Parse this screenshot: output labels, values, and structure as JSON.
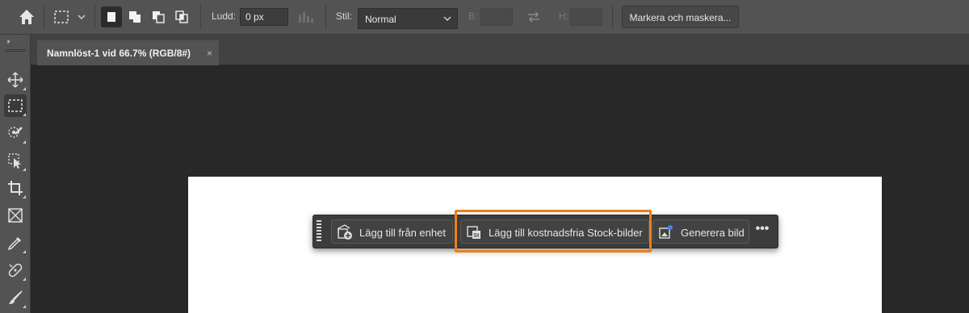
{
  "options_bar": {
    "feather_label": "Ludd:",
    "feather_value": "0 px",
    "style_label": "Stil:",
    "style_value": "Normal",
    "width_label": "B:",
    "height_label": "H:",
    "select_mask_label": "Markera och maskera..."
  },
  "document_tab": {
    "title": "Namnlöst-1 vid 66.7% (RGB/8#)",
    "close_glyph": "×"
  },
  "toolbar": {
    "collapse_glyph": "››",
    "tools": [
      "move-icon",
      "rect-marquee-icon",
      "object-select-icon",
      "quick-select-icon",
      "crop-icon",
      "frame-icon",
      "eyedropper-icon",
      "healing-brush-icon",
      "brush-icon"
    ]
  },
  "context_task_bar": {
    "add_from_device": "Lägg till från enhet",
    "add_stock_images": "Lägg till kostnadsfria Stock-bilder",
    "generate_image": "Generera bild",
    "more_glyph": "•••"
  },
  "colors": {
    "highlight": "#e8801f",
    "panel": "#535353",
    "workspace": "#282828",
    "canvas": "#ffffff"
  }
}
